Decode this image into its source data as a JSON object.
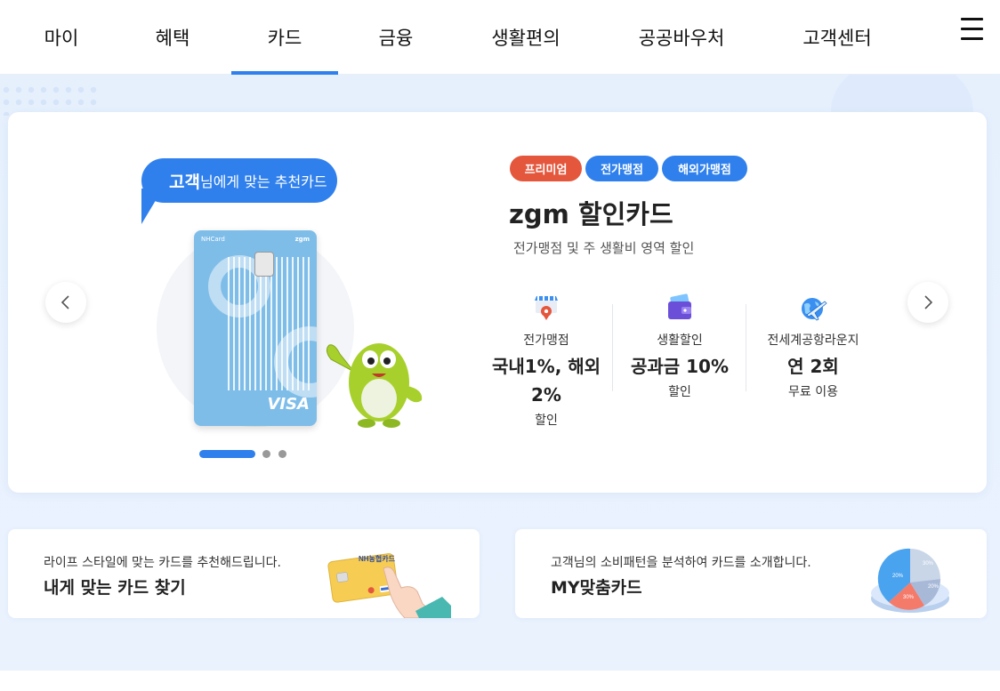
{
  "nav": {
    "tabs": [
      {
        "label": "마이"
      },
      {
        "label": "혜택"
      },
      {
        "label": "카드"
      },
      {
        "label": "금융"
      },
      {
        "label": "생활편의"
      },
      {
        "label": "공공바우처"
      },
      {
        "label": "고객센터"
      }
    ],
    "active_tab": "카드"
  },
  "hero": {
    "bubble_bold": "고객",
    "bubble_rest": "님에게 맞는 추천카드",
    "card_face": {
      "brand_tl": "NHCard",
      "brand_tr": "zgm",
      "network": "VISA"
    },
    "tags": [
      {
        "label": "프리미엄",
        "color": "#e4573d"
      },
      {
        "label": "전가맹점",
        "color": "#2f80ed"
      },
      {
        "label": "해외가맹점",
        "color": "#2f80ed"
      }
    ],
    "card_name": "zgm 할인카드",
    "card_desc": "전가맹점 및 주 생활비 영역 할인",
    "benefits": [
      {
        "icon": "store-location-icon",
        "title": "전가맹점",
        "value_line1": "국내1%, 해외",
        "value_line2": "2%",
        "sub": "할인"
      },
      {
        "icon": "wallet-icon",
        "title": "생활할인",
        "value_line1": "공과금 10%",
        "value_line2": "",
        "sub": "할인"
      },
      {
        "icon": "airplane-globe-icon",
        "title": "전세계공항라운지",
        "value_line1": "연 2회",
        "value_line2": "",
        "sub": "무료 이용"
      }
    ],
    "pagination": {
      "total": 3,
      "current": 1
    }
  },
  "promos": [
    {
      "sub": "라이프 스타일에 맞는 카드를 추천해드립니다.",
      "title": "내게 맞는 카드 찾기",
      "card_label": "NH농협카드"
    },
    {
      "sub": "고객님의 소비패턴을 분석하여 카드를 소개합니다.",
      "title": "MY맞춤카드",
      "chart_labels": [
        "30%",
        "20%",
        "30%",
        "20%"
      ]
    }
  ],
  "colors": {
    "accent": "#2f80ed",
    "premium": "#e4573d",
    "bg": "#e6f0fd"
  }
}
